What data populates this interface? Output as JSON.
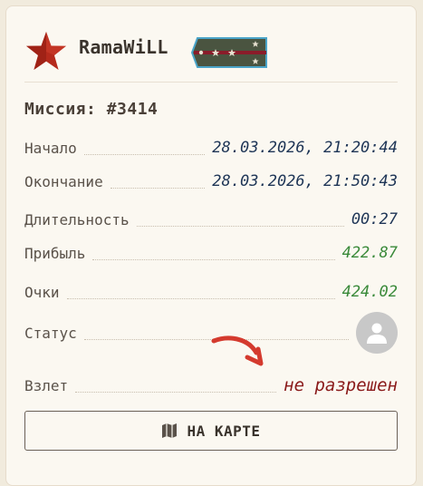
{
  "user": {
    "name": "RamaWiLL",
    "rank_icon": "shoulder-strap-icon",
    "avatar_icon": "star-icon"
  },
  "mission": {
    "label": "Миссия:",
    "number": "#3414"
  },
  "fields": [
    {
      "label": "Начало",
      "value": "28.03.2026, 21:20:44",
      "color": "#1e3556"
    },
    {
      "label": "Окончание",
      "value": "28.03.2026, 21:50:43",
      "color": "#1e3556"
    },
    {
      "label": "Длительность",
      "value": "00:27",
      "color": "#1e3556"
    },
    {
      "label": "Прибыль",
      "value": "422.87",
      "color": "#3a8a3a"
    },
    {
      "label": "Очки",
      "value": "424.02",
      "color": "#3a8a3a"
    },
    {
      "label": "Статус",
      "value_icon": "user-avatar-icon"
    },
    {
      "label": "Взлет",
      "value": "не разрешен",
      "color": "#8a1a1a"
    }
  ],
  "button": {
    "label": "НА КАРТЕ",
    "icon": "map-icon"
  },
  "colors": {
    "star": "#b52a1c",
    "arrow": "#d43a2e",
    "rank_bg": "#4a5440",
    "rank_stripe": "#8a1c2a",
    "rank_border": "#4aa4c8"
  }
}
